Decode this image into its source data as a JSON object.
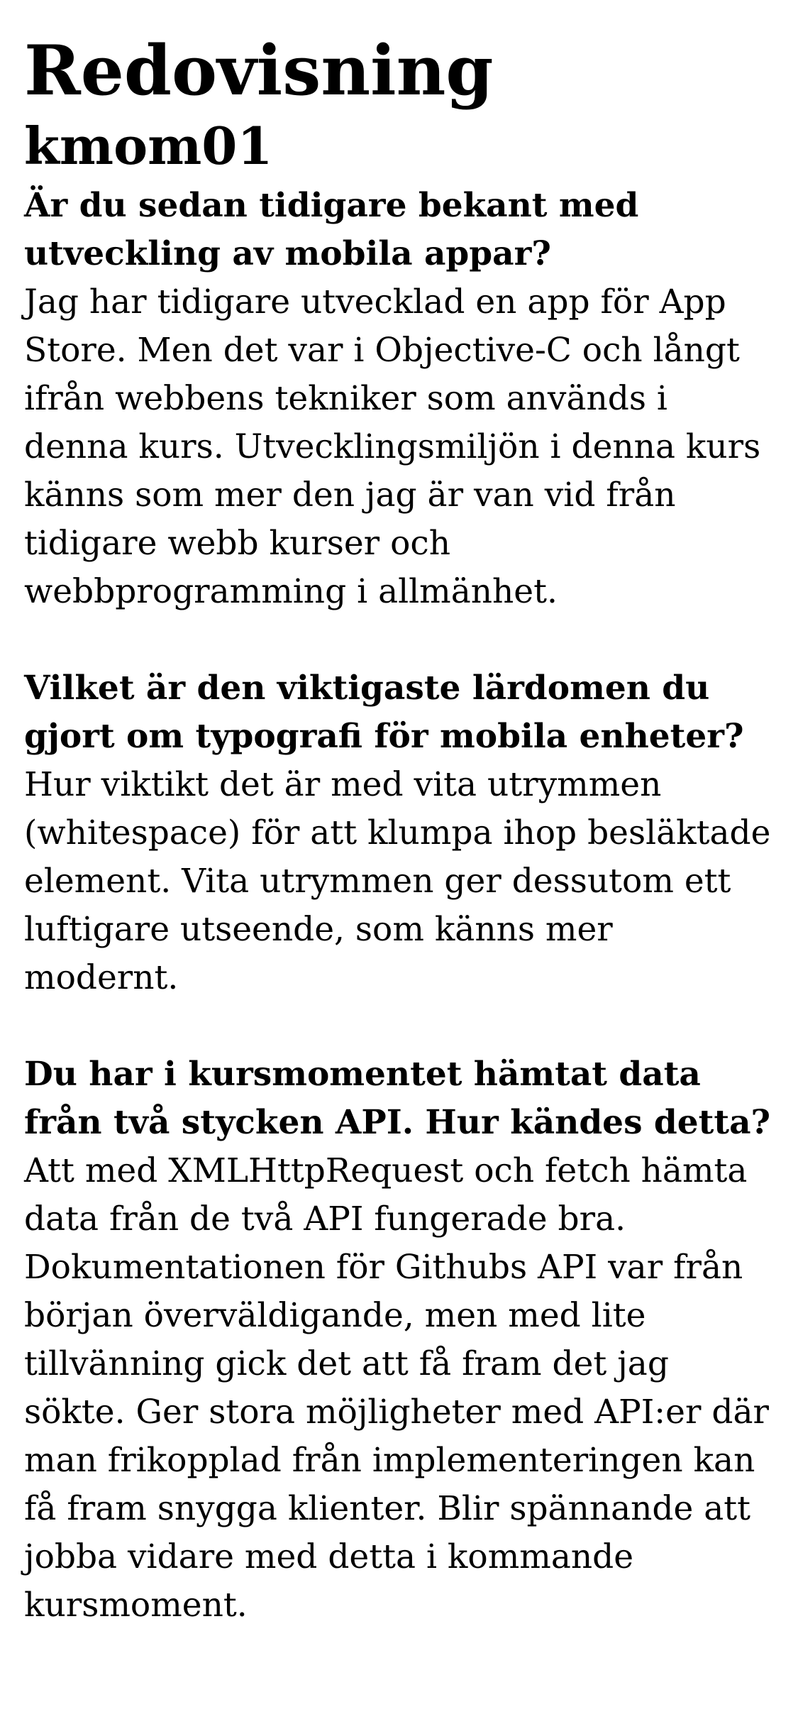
{
  "page": {
    "title": "Redovisning",
    "subtitle": "kmom01"
  },
  "sections": [
    {
      "question": "Är du sedan tidigare bekant med utveckling av mobila appar?",
      "answer": "Jag har tidigare utvecklad en app för App Store. Men det var i Objective-C och långt ifrån webbens tekniker som används i denna kurs. Utvecklingsmiljön i denna kurs känns som mer den jag är van vid från tidigare webb kurser och webbprogramming i allmänhet."
    },
    {
      "question": "Vilket är den viktigaste lärdomen du gjort om typografi för mobila enheter?",
      "answer": "Hur viktikt det är med vita utrymmen (whitespace) för att klumpa ihop besläktade element. Vita utrymmen ger dessutom ett luftigare utseende, som känns mer modernt."
    },
    {
      "question": "Du har i kursmomentet hämtat data från två stycken API. Hur kändes detta?",
      "answer": "Att med XMLHttpRequest och fetch hämta data från de två API fungerade bra. Dokumentationen för Githubs API var från början överväldigande, men med lite tillvänning gick det att få fram det jag sökte. Ger stora möjligheter med API:er där man frikopplad från implementeringen kan få fram snygga klienter. Blir spännande att jobba vidare med detta i kommande kursmoment."
    }
  ]
}
